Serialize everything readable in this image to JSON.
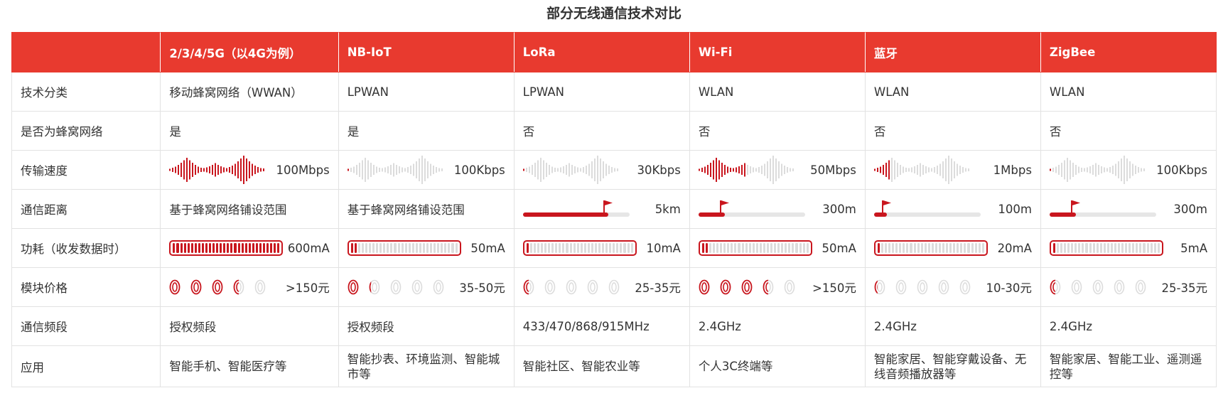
{
  "title": "部分无线通信技术对比",
  "colors": {
    "accent": "#e83a2f",
    "fill": "#c9161e",
    "empty": "#dcdcdc"
  },
  "columns": [
    "2/3/4/5G（以4G为例）",
    "NB-IoT",
    "LoRa",
    "Wi-Fi",
    "蓝牙",
    "ZigBee"
  ],
  "row_labels": {
    "category": "技术分类",
    "cellular": "是否为蜂窝网络",
    "speed": "传输速度",
    "distance": "通信距离",
    "power": "功耗（收发数据时）",
    "price": "模块价格",
    "band": "通信频段",
    "application": "应用"
  },
  "chart_data": {
    "type": "table",
    "title": "部分无线通信技术对比",
    "category": [
      "移动蜂窝网络（WWAN）",
      "LPWAN",
      "LPWAN",
      "WLAN",
      "WLAN",
      "WLAN"
    ],
    "cellular": [
      "是",
      "是",
      "否",
      "否",
      "否",
      "否"
    ],
    "speed": {
      "labels": [
        "100Mbps",
        "100Kbps",
        "30Kbps",
        "50Mbps",
        "1Mbps",
        "100Kbps"
      ],
      "level": [
        1.0,
        0.04,
        0.03,
        0.5,
        0.18,
        0.04
      ]
    },
    "distance": {
      "labels": [
        "基于蜂窝网络铺设范围",
        "基于蜂窝网络铺设范围",
        "5km",
        "300m",
        "100m",
        "300m"
      ],
      "level": [
        null,
        null,
        0.8,
        0.25,
        0.12,
        0.25
      ]
    },
    "power": {
      "labels": [
        "600mA",
        "50mA",
        "10mA",
        "50mA",
        "20mA",
        "5mA"
      ],
      "level": [
        1.0,
        0.083,
        0.03,
        0.083,
        0.04,
        0.01
      ]
    },
    "price": {
      "labels": [
        ">150元",
        "35-50元",
        "25-35元",
        ">150元",
        "10-30元",
        "25-35元"
      ],
      "coins": [
        3.5,
        1.2,
        0.5,
        3.5,
        0.3,
        0.5
      ]
    },
    "band": [
      "授权频段",
      "授权频段",
      "433/470/868/915MHz",
      "2.4GHz",
      "2.4GHz",
      "2.4GHz"
    ],
    "application": [
      "智能手机、智能医疗等",
      "智能抄表、环境监测、智能城市等",
      "智能社区、智能农业等",
      "个人3C终端等",
      "智能家居、智能穿戴设备、无线音频播放器等",
      "智能家居、智能工业、遥测遥控等"
    ]
  }
}
